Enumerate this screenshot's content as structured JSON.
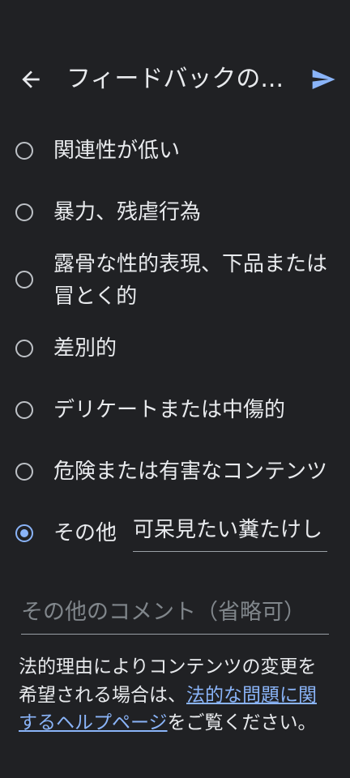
{
  "header": {
    "back_icon": "arrow-left-icon",
    "title": "フィードバックの...",
    "send_icon": "send-icon"
  },
  "options": [
    {
      "label": "関連性が低い",
      "selected": false
    },
    {
      "label": "暴力、残虐行為",
      "selected": false
    },
    {
      "label_line1": "露骨な性的表現、下品または",
      "label_line2": "冒とく的",
      "selected": false
    },
    {
      "label": "差別的",
      "selected": false
    },
    {
      "label": "デリケートまたは中傷的",
      "selected": false
    },
    {
      "label": "危険または有害なコンテンツ",
      "selected": false
    },
    {
      "label": "その他",
      "selected": true,
      "input_value": "可呆見たい糞たけし"
    }
  ],
  "comment": {
    "placeholder": "その他のコメント（省略可）"
  },
  "legal": {
    "text_before": "法的理由によりコンテンツの変更を希望される場合は、",
    "link_text": "法的な問題に関するヘルプページ",
    "text_after": "をご覧ください。"
  },
  "colors": {
    "background": "#202124",
    "text": "#e8eaed",
    "accent": "#8ab4f8",
    "radio_border": "#bdc1c6",
    "placeholder": "#80868b"
  }
}
